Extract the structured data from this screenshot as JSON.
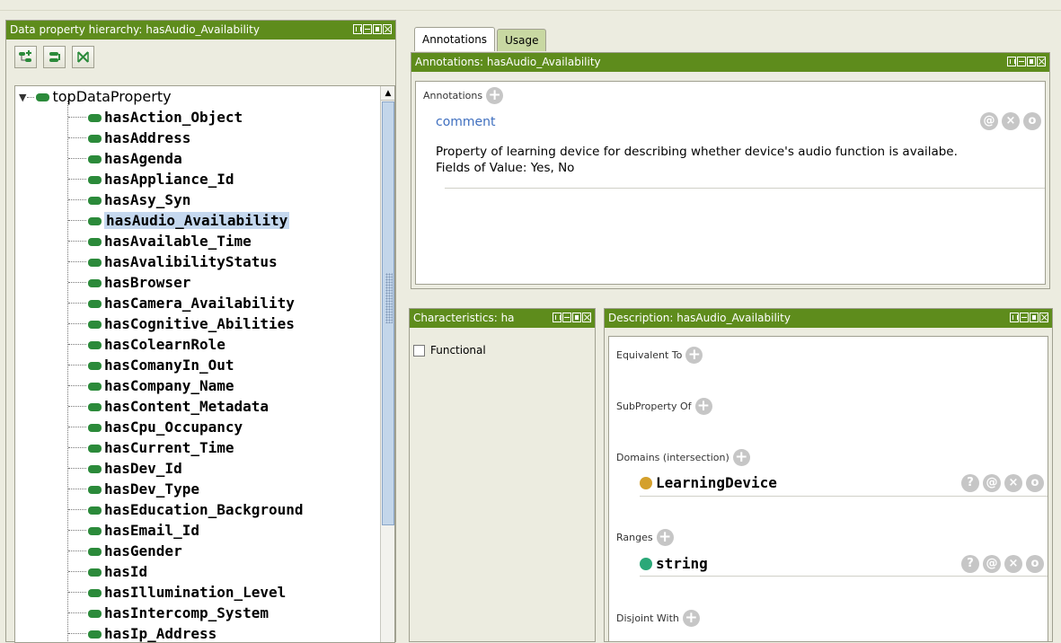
{
  "left_panel": {
    "title": "Data property hierarchy: hasAudio_Availability",
    "tree": {
      "root": "topDataProperty",
      "children": [
        "hasAction_Object",
        "hasAddress",
        "hasAgenda",
        "hasAppliance_Id",
        "hasAsy_Syn",
        "hasAudio_Availability",
        "hasAvailable_Time",
        "hasAvalibilityStatus",
        "hasBrowser",
        "hasCamera_Availability",
        "hasCognitive_Abilities",
        "hasColearnRole",
        "hasComanyIn_Out",
        "hasCompany_Name",
        "hasContent_Metadata",
        "hasCpu_Occupancy",
        "hasCurrent_Time",
        "hasDev_Id",
        "hasDev_Type",
        "hasEducation_Background",
        "hasEmail_Id",
        "hasGender",
        "hasId",
        "hasIllumination_Level",
        "hasIntercomp_System",
        "hasIp_Address"
      ],
      "selected_index": 5
    }
  },
  "tabs": {
    "annotations": "Annotations",
    "usage": "Usage"
  },
  "annotations_panel": {
    "title": "Annotations: hasAudio_Availability",
    "section_label": "Annotations",
    "property": "comment",
    "text_line1": "Property of learning device for describing whether device's audio function is availabe.",
    "text_line2": "Fields of Value: Yes, No"
  },
  "characteristics_panel": {
    "title": "Characteristics: ha",
    "functional_label": "Functional"
  },
  "description_panel": {
    "title": "Description: hasAudio_Availability",
    "equivalent_to": "Equivalent To",
    "subproperty_of": "SubProperty Of",
    "domains": "Domains (intersection)",
    "domain_value": "LearningDevice",
    "ranges": "Ranges",
    "range_value": "string",
    "disjoint_with": "Disjoint With"
  },
  "colors": {
    "titlebar": "#5e8c1c",
    "property_pill": "#2b8a3a",
    "class_dot": "#d4a02c",
    "datatype_dot": "#2aa878",
    "selection": "#c5d8ef",
    "comment_link": "#3f6fbf"
  },
  "icons": {
    "plus": "+",
    "at": "@",
    "cross": "×",
    "circle": "o",
    "question": "?"
  }
}
